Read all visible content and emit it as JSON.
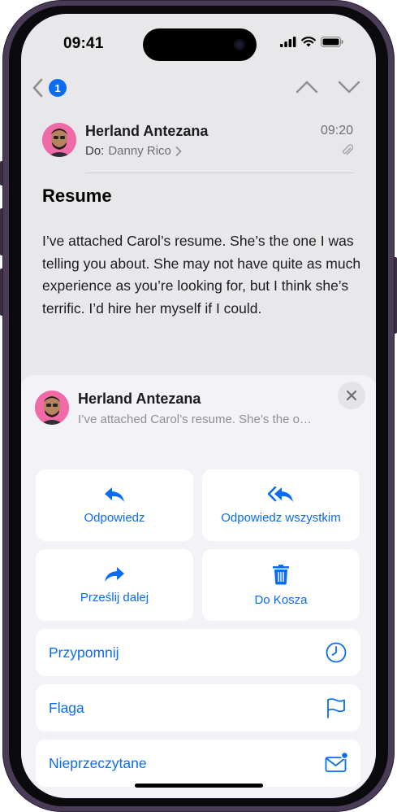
{
  "status_bar": {
    "time": "09:41"
  },
  "nav": {
    "unread_badge": "1"
  },
  "email": {
    "sender": "Herland Antezana",
    "to_label": "Do:",
    "to_name": "Danny Rico",
    "time": "09:20",
    "subject": "Resume",
    "body": "I’ve attached Carol’s resume. She’s the one I was telling you about. She may not have quite as much experience as you’re looking for, but I think she’s terrific. I’d hire her myself if I could."
  },
  "sheet": {
    "sender": "Herland Antezana",
    "preview": "I’ve attached Carol’s resume. She’s the o…",
    "actions": {
      "reply": "Odpowiedz",
      "reply_all": "Odpowiedz wszystkim",
      "forward": "Prześlij dalej",
      "trash": "Do Kosza"
    },
    "rows": {
      "remind": "Przypomnij",
      "flag": "Flaga",
      "unread": "Nieprzeczytane"
    }
  },
  "colors": {
    "accent": "#0a6cf0",
    "avatar_bg": "#f06aa8",
    "frame": "#4a3b57"
  }
}
